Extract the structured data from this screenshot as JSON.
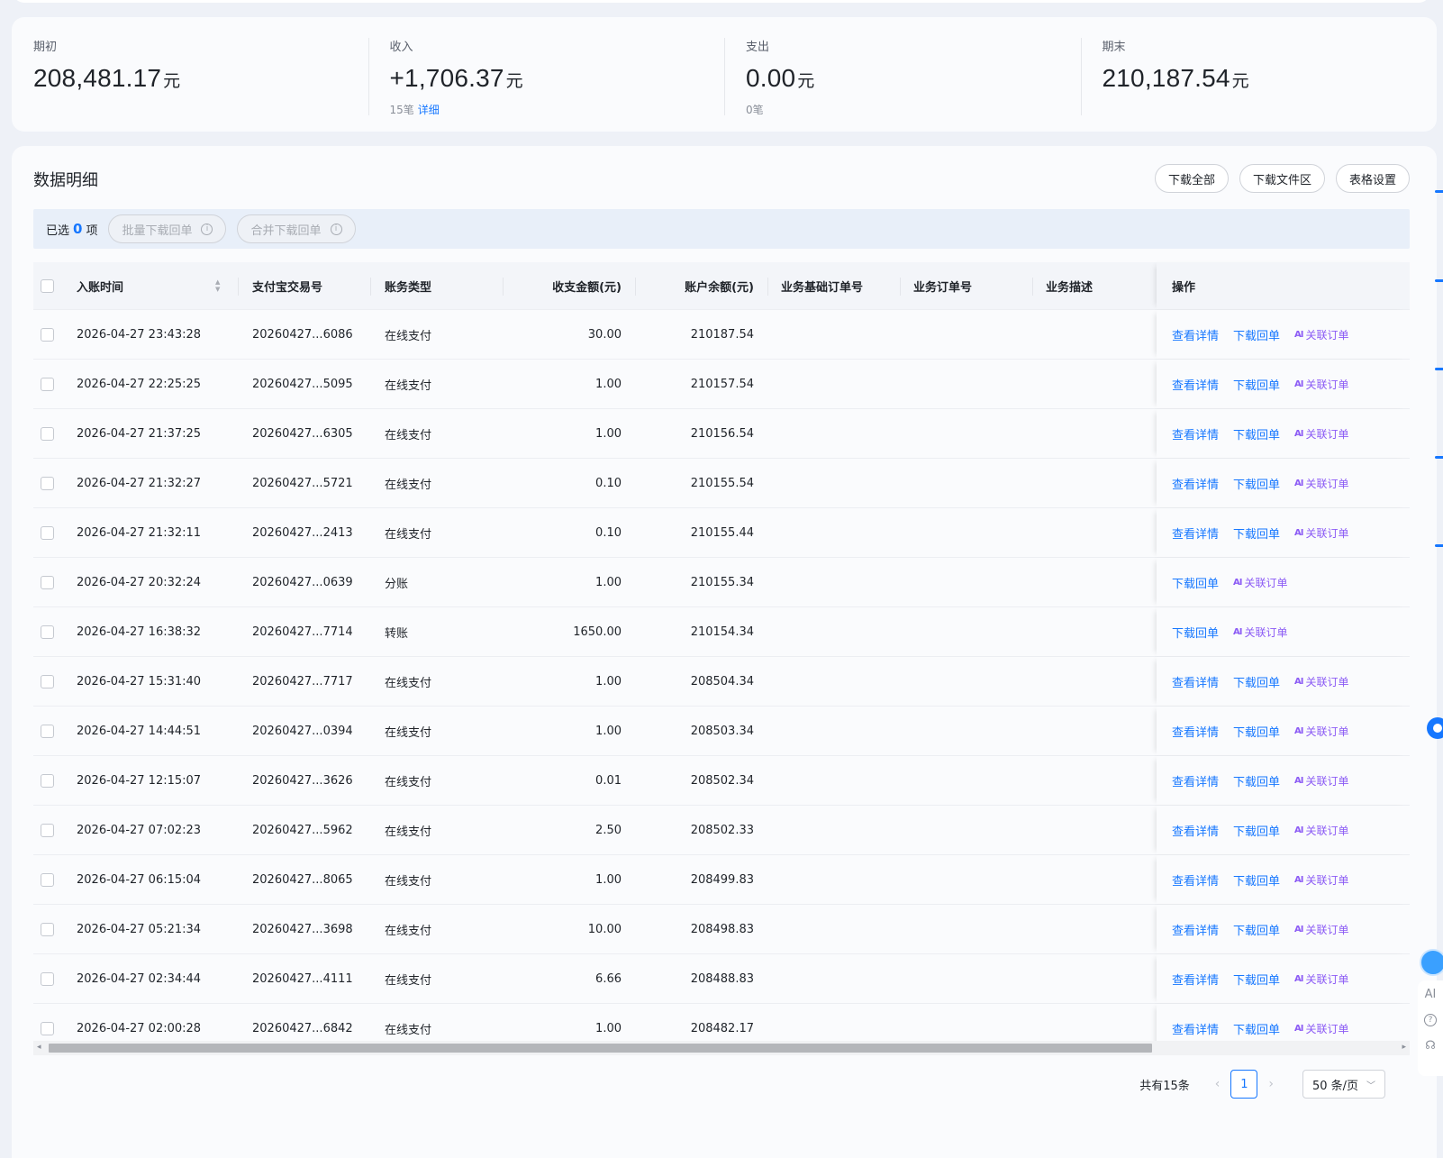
{
  "summary": [
    {
      "label": "期初",
      "value": "208,481.17",
      "unit": "元",
      "sub": "",
      "sub_link": ""
    },
    {
      "label": "收入",
      "value": "+1,706.37",
      "unit": "元",
      "sub": "15笔",
      "sub_link": "详细"
    },
    {
      "label": "支出",
      "value": "0.00",
      "unit": "元",
      "sub": "0笔",
      "sub_link": ""
    },
    {
      "label": "期末",
      "value": "210,187.54",
      "unit": "元",
      "sub": "",
      "sub_link": ""
    }
  ],
  "detail": {
    "title": "数据明细",
    "buttons": {
      "download_all": "下载全部",
      "download_files": "下载文件区",
      "table_settings": "表格设置"
    }
  },
  "selection": {
    "prefix": "已选",
    "count": "0",
    "suffix": "项",
    "batch_download": "批量下载回单",
    "merge_download": "合并下载回单"
  },
  "table": {
    "headers": {
      "time": "入账时间",
      "trade_no": "支付宝交易号",
      "type": "账务类型",
      "amount": "收支金额(元)",
      "balance": "账户余额(元)",
      "base_order": "业务基础订单号",
      "order": "业务订单号",
      "desc": "业务描述",
      "ops": "操作"
    },
    "op_labels": {
      "view": "查看详情",
      "download": "下载回单",
      "relate": "关联订单",
      "relate_icon": "AI"
    },
    "rows": [
      {
        "time": "2026-04-27 23:43:28",
        "no": "20260427...6086",
        "type": "在线支付",
        "amount": "30.00",
        "balance": "210187.54",
        "view": true
      },
      {
        "time": "2026-04-27 22:25:25",
        "no": "20260427...5095",
        "type": "在线支付",
        "amount": "1.00",
        "balance": "210157.54",
        "view": true
      },
      {
        "time": "2026-04-27 21:37:25",
        "no": "20260427...6305",
        "type": "在线支付",
        "amount": "1.00",
        "balance": "210156.54",
        "view": true
      },
      {
        "time": "2026-04-27 21:32:27",
        "no": "20260427...5721",
        "type": "在线支付",
        "amount": "0.10",
        "balance": "210155.54",
        "view": true
      },
      {
        "time": "2026-04-27 21:32:11",
        "no": "20260427...2413",
        "type": "在线支付",
        "amount": "0.10",
        "balance": "210155.44",
        "view": true
      },
      {
        "time": "2026-04-27 20:32:24",
        "no": "20260427...0639",
        "type": "分账",
        "amount": "1.00",
        "balance": "210155.34",
        "view": false
      },
      {
        "time": "2026-04-27 16:38:32",
        "no": "20260427...7714",
        "type": "转账",
        "amount": "1650.00",
        "balance": "210154.34",
        "view": false
      },
      {
        "time": "2026-04-27 15:31:40",
        "no": "20260427...7717",
        "type": "在线支付",
        "amount": "1.00",
        "balance": "208504.34",
        "view": true
      },
      {
        "time": "2026-04-27 14:44:51",
        "no": "20260427...0394",
        "type": "在线支付",
        "amount": "1.00",
        "balance": "208503.34",
        "view": true
      },
      {
        "time": "2026-04-27 12:15:07",
        "no": "20260427...3626",
        "type": "在线支付",
        "amount": "0.01",
        "balance": "208502.34",
        "view": true
      },
      {
        "time": "2026-04-27 07:02:23",
        "no": "20260427...5962",
        "type": "在线支付",
        "amount": "2.50",
        "balance": "208502.33",
        "view": true
      },
      {
        "time": "2026-04-27 06:15:04",
        "no": "20260427...8065",
        "type": "在线支付",
        "amount": "1.00",
        "balance": "208499.83",
        "view": true
      },
      {
        "time": "2026-04-27 05:21:34",
        "no": "20260427...3698",
        "type": "在线支付",
        "amount": "10.00",
        "balance": "208498.83",
        "view": true
      },
      {
        "time": "2026-04-27 02:34:44",
        "no": "20260427...4111",
        "type": "在线支付",
        "amount": "6.66",
        "balance": "208488.83",
        "view": true
      },
      {
        "time": "2026-04-27 02:00:28",
        "no": "20260427...6842",
        "type": "在线支付",
        "amount": "1.00",
        "balance": "208482.17",
        "view": true
      }
    ]
  },
  "pagination": {
    "total": "共有15条",
    "current": "1",
    "page_size": "50 条/页"
  },
  "side_tools": {
    "ai": "AI",
    "help": "?"
  }
}
